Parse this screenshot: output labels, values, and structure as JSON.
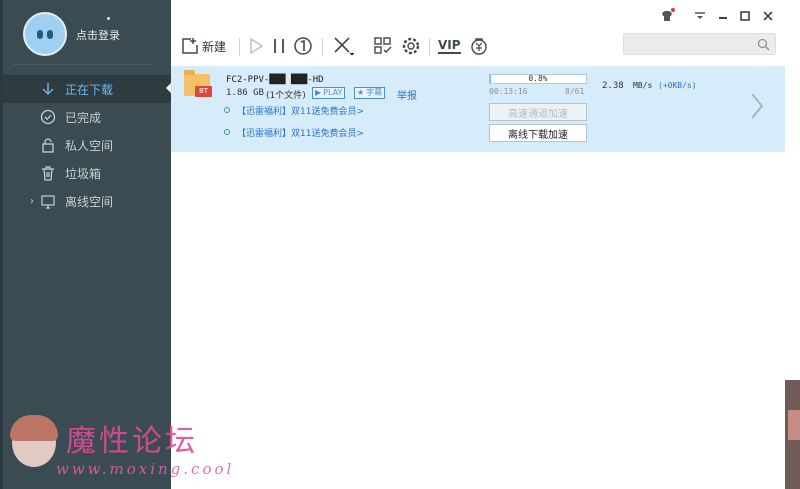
{
  "sidebar": {
    "login_label": "点击登录",
    "items": [
      {
        "label": "正在下载",
        "icon": "download-arrow-icon",
        "active": true
      },
      {
        "label": "已完成",
        "icon": "check-circle-icon",
        "active": false
      },
      {
        "label": "私人空间",
        "icon": "lock-icon",
        "active": false
      },
      {
        "label": "垃圾箱",
        "icon": "trash-icon",
        "active": false
      },
      {
        "label": "离线空间",
        "icon": "cloud-monitor-icon",
        "active": false
      }
    ]
  },
  "titlebar": {
    "buttons": [
      "skin-icon",
      "menu-icon",
      "minimize-icon",
      "maximize-icon",
      "close-icon"
    ]
  },
  "toolbar": {
    "new_label": "新建",
    "tools": [
      "new-icon",
      "play-icon",
      "pause-icon",
      "limit-speed-icon",
      "delete-icon",
      "grid-icon",
      "settings-icon",
      "vip-icon",
      "wallet-icon"
    ],
    "vip_text": "VIP"
  },
  "search": {
    "placeholder": ""
  },
  "task": {
    "name": "FC2-PPV-███ ███-HD",
    "size": "1.86 GB",
    "files": "(1个文件)",
    "badge": "BT",
    "play_label": "PLAY",
    "subtitle_label": "字幕",
    "report_label": "举报",
    "progress_text": "0.8%",
    "progress_fraction": 0.008,
    "elapsed": "00:13:16",
    "peers": "8/61",
    "speed": "2.38",
    "speed_unit": "MB/s",
    "speed_extra": "(+0KB/s)",
    "speedup_label": "高速通道加速",
    "offline_label": "离线下载加速",
    "promos": [
      "【迅雷福利】双11送免费会员>",
      "【迅雷福利】双11送免费会员>"
    ]
  },
  "watermark": {
    "title": "魔性论坛",
    "url": "www.moxing.cool"
  },
  "colors": {
    "sidebar_bg": "#3a4b52",
    "accent": "#6bb8ee",
    "task_row_bg": "#d7ecfb"
  }
}
